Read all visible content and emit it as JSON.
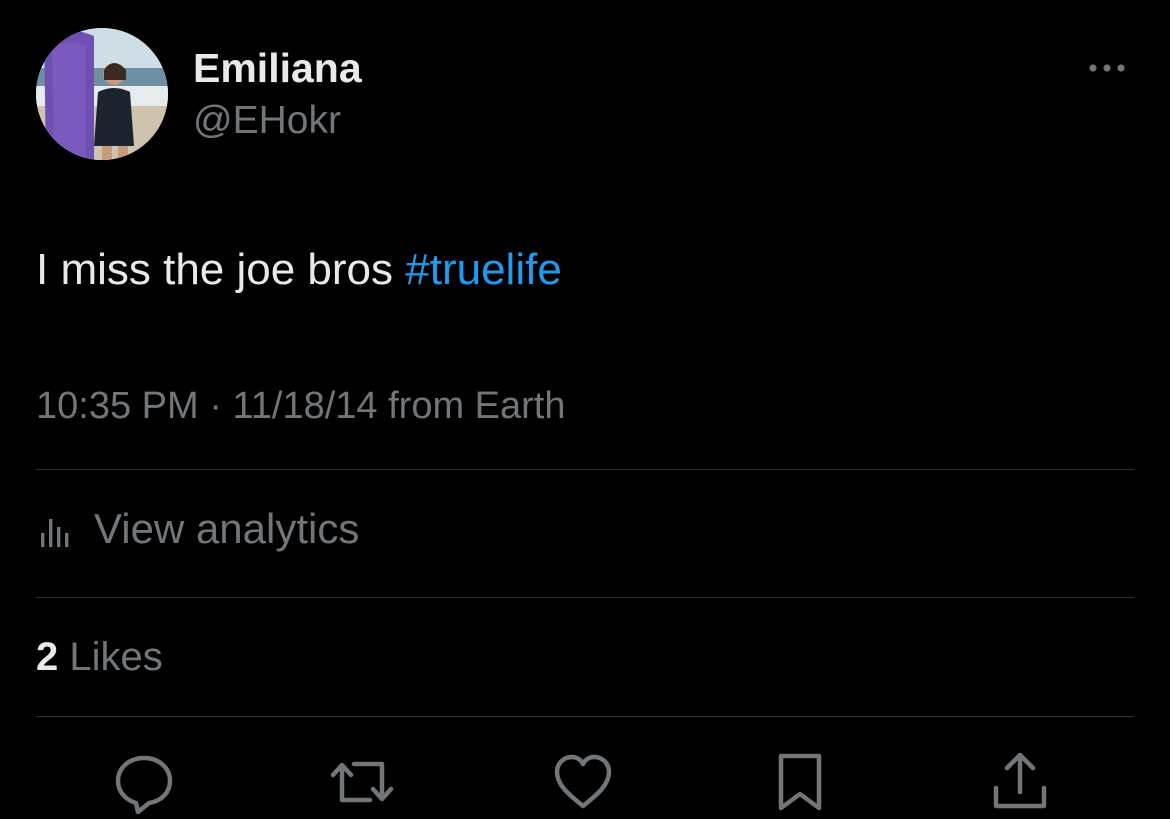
{
  "author": {
    "display_name": "Emiliana",
    "handle": "@EHokr",
    "avatar_icon": "profile-photo"
  },
  "tweet": {
    "text": "I miss the joe bros ",
    "hashtag": "#truelife",
    "timestamp": "10:35 PM",
    "separator": " · ",
    "date": "11/18/14",
    "source": " from Earth"
  },
  "analytics": {
    "icon": "bar-chart-icon",
    "label": "View analytics"
  },
  "likes": {
    "count": "2",
    "label": " Likes"
  },
  "actions": {
    "reply_icon": "reply-icon",
    "retweet_icon": "retweet-icon",
    "like_icon": "heart-icon",
    "bookmark_icon": "bookmark-icon",
    "share_icon": "share-icon",
    "more_icon": "more-options-icon"
  },
  "colors": {
    "background": "#000000",
    "primary_text": "#e7e9ea",
    "secondary_text": "#71767b",
    "link": "#1d9bf0",
    "divider": "#2f3336"
  }
}
